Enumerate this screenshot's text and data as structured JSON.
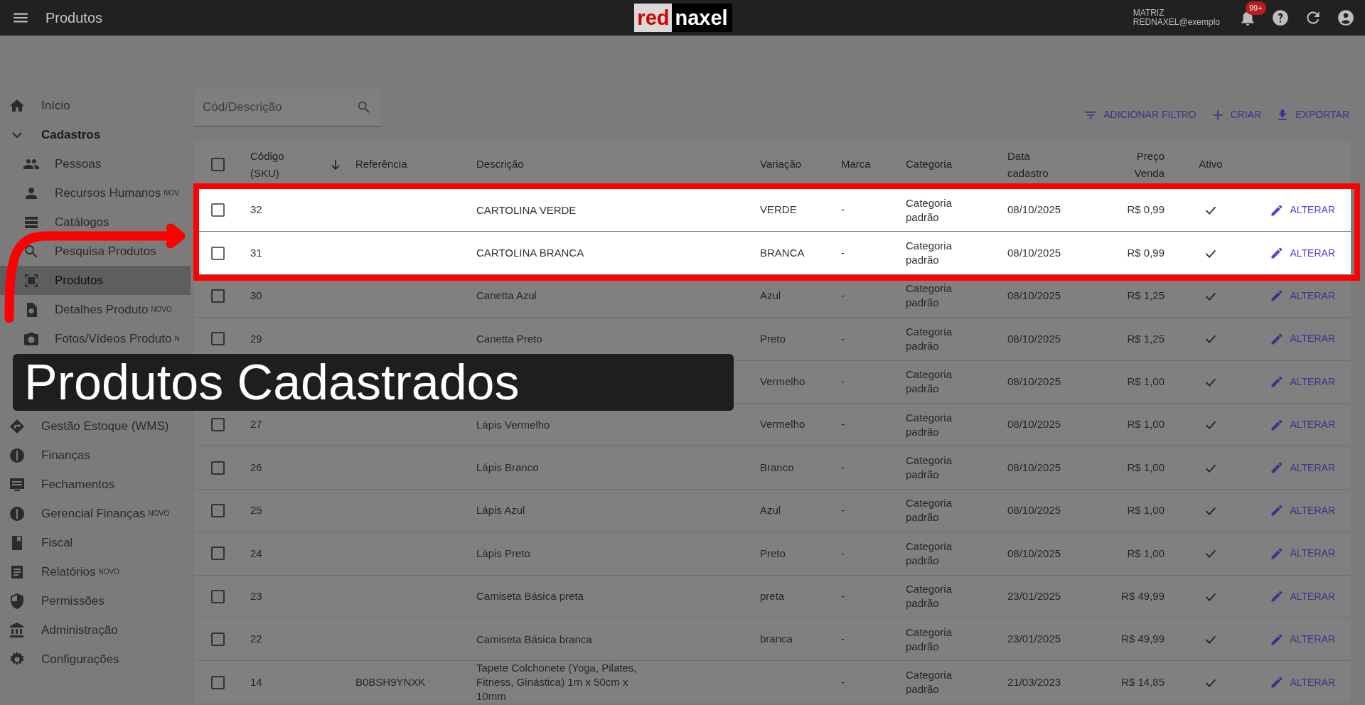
{
  "app_bar": {
    "title": "Produtos",
    "logo": {
      "left": "red",
      "right": "naxel"
    },
    "user": {
      "company": "MATRIZ",
      "email": "REDNAXEL@exemplo"
    },
    "notifications": {
      "badge": "99+"
    }
  },
  "sidebar": {
    "items": [
      {
        "label": "Início",
        "selected": false
      },
      {
        "label": "Cadastros",
        "selected": false,
        "expanded": true,
        "children": [
          {
            "label": "Pessoas",
            "selected": false
          },
          {
            "label": "Recursos Humanos",
            "tag": "NOV",
            "selected": false
          },
          {
            "label": "Catálogos",
            "selected": false
          },
          {
            "label": "Pesquisa Produtos",
            "selected": false
          },
          {
            "label": "Produtos",
            "selected": true
          },
          {
            "label": "Detalhes Produto",
            "tag": "NOVO",
            "selected": false
          },
          {
            "label": "Fotos/Vídeos Produto",
            "tag": "N",
            "selected": false
          }
        ]
      },
      {
        "label": "Gestão Estoque (WMS)",
        "selected": false
      },
      {
        "label": "Finanças",
        "selected": false
      },
      {
        "label": "Fechamentos",
        "selected": false
      },
      {
        "label": "Gerencial Finanças",
        "tag": "NOVO",
        "selected": false
      },
      {
        "label": "Fiscal",
        "selected": false
      },
      {
        "label": "Relatórios",
        "tag": "NOVO",
        "selected": false
      },
      {
        "label": "Permissões",
        "selected": false
      },
      {
        "label": "Administração",
        "selected": false
      },
      {
        "label": "Configurações",
        "selected": false
      }
    ]
  },
  "search": {
    "placeholder": "Cód/Descrição"
  },
  "actions": [
    "ADICIONAR FILTRO",
    "CRIAR",
    "EXPORTAR"
  ],
  "table": {
    "select_all": {
      "checked": false
    },
    "columns": [
      {
        "label": "Código (SKU)",
        "sorted": true
      },
      {
        "label": "Referência"
      },
      {
        "label": "Descrição"
      },
      {
        "label": "Variação"
      },
      {
        "label": "Marca"
      },
      {
        "label": "Categoria"
      },
      {
        "label": "Data cadastro"
      },
      {
        "label": "Preço Venda"
      },
      {
        "label": "Ativo"
      }
    ],
    "rows": [
      {
        "selected": false,
        "code": "32",
        "description": "CARTOLINA VERDE",
        "variation": "VERDE",
        "brand": "-",
        "category": "Categoria padrão",
        "date": "08/10/2025",
        "price": "R$ 0,99",
        "active": true,
        "action": "ALTERAR",
        "highlighted": true
      },
      {
        "selected": false,
        "code": "31",
        "description": "CARTOLINA BRANCA",
        "variation": "BRANCA",
        "brand": "-",
        "category": "Categoria padrão",
        "date": "08/10/2025",
        "price": "R$ 0,99",
        "active": true,
        "action": "ALTERAR",
        "highlighted": true
      },
      {
        "selected": false,
        "code": "30",
        "description": "Canetta Azul",
        "variation": "Azul",
        "brand": "-",
        "category": "Categoria padrão",
        "date": "08/10/2025",
        "price": "R$ 1,25",
        "active": true,
        "action": "ALTERAR",
        "highlighted": false
      },
      {
        "selected": false,
        "code": "29",
        "description": "Canetta Preto",
        "variation": "Preto",
        "brand": "-",
        "category": "Categoria padrão",
        "date": "08/10/2025",
        "price": "R$ 1,25",
        "active": true,
        "action": "ALTERAR",
        "highlighted": false
      },
      {
        "variation": "Vermelho",
        "brand": "-",
        "category": "Categoria padrão",
        "date": "08/10/2025",
        "price": "R$ 1,00",
        "active": true,
        "action": "ALTERAR",
        "highlighted": false
      },
      {
        "selected": false,
        "code": "27",
        "description": "Lápis Vermelho",
        "variation": "Vermelho",
        "brand": "-",
        "category": "Categoria padrão",
        "date": "08/10/2025",
        "price": "R$ 1,00",
        "active": true,
        "action": "ALTERAR",
        "highlighted": false
      },
      {
        "selected": false,
        "code": "26",
        "description": "Lápis Branco",
        "variation": "Branco",
        "brand": "-",
        "category": "Categoria padrão",
        "date": "08/10/2025",
        "price": "R$ 1,00",
        "active": true,
        "action": "ALTERAR",
        "highlighted": false
      },
      {
        "selected": false,
        "code": "25",
        "description": "Lápis Azul",
        "variation": "Azul",
        "brand": "-",
        "category": "Categoria padrão",
        "date": "08/10/2025",
        "price": "R$ 1,00",
        "active": true,
        "action": "ALTERAR",
        "highlighted": false
      },
      {
        "selected": false,
        "code": "24",
        "description": "Lápis Preto",
        "variation": "Preto",
        "brand": "-",
        "category": "Categoria padrão",
        "date": "08/10/2025",
        "price": "R$ 1,00",
        "active": true,
        "action": "ALTERAR",
        "highlighted": false
      },
      {
        "selected": false,
        "code": "23",
        "description": "Camiseta Básica preta",
        "variation": "preta",
        "brand": "-",
        "category": "Categoria padrão",
        "date": "23/01/2025",
        "price": "R$ 49,99",
        "active": true,
        "action": "ALTERAR",
        "highlighted": false
      },
      {
        "selected": false,
        "code": "22",
        "description": "Camiseta Básica branca",
        "variation": "branca",
        "brand": "-",
        "category": "Categoria padrão",
        "date": "23/01/2025",
        "price": "R$ 49,99",
        "active": true,
        "action": "ALTERAR",
        "highlighted": false
      },
      {
        "selected": false,
        "code": "14",
        "reference": "B0BSH9YNXK",
        "description": "Tapete Colchonete (Yoga, Pilates, Fitness, Ginástica) 1m x 50cm x 10mm",
        "brand": "-",
        "category": "Categoria padrão",
        "date": "21/03/2023",
        "price": "R$ 14,85",
        "active": true,
        "action": "ALTERAR",
        "highlighted": false
      }
    ]
  },
  "caption": "Produtos Cadastrados"
}
